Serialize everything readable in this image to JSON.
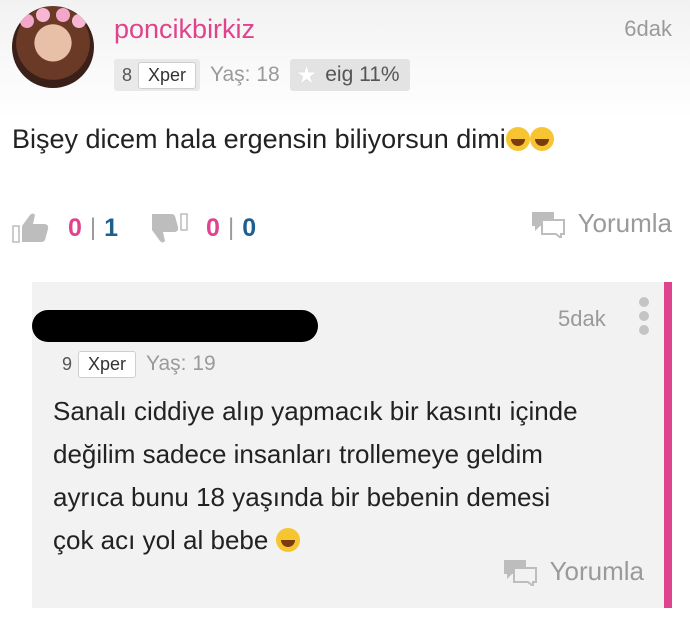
{
  "post": {
    "username": "poncikbirkiz",
    "time": "6dak",
    "level": "8",
    "level_tag": "Xper",
    "age": "Yaş: 18",
    "eig": "eig 11%",
    "text": "Bişey dicem hala ergensin biliyorsun dimi",
    "likes": {
      "pink": "0",
      "blue": "1"
    },
    "dislikes": {
      "pink": "0",
      "blue": "0"
    },
    "separator": "|",
    "reply_label": "Yorumla"
  },
  "reply": {
    "time": "5dak",
    "level": "9",
    "level_tag": "Xper",
    "age": "Yaş: 19",
    "lines": [
      "Sanalı ciddiye alıp yapmacık bir kasıntı içinde",
      "değilim sadece insanları trollemeye geldim",
      "ayrıca bunu 18 yaşında bir bebenin demesi",
      "çok acı yol al bebe"
    ],
    "reply_label": "Yorumla"
  },
  "colors": {
    "accent_pink": "#e0438d",
    "count_blue": "#1f5f8f",
    "muted_gray": "#9a9a9a"
  },
  "icons": [
    "avatar",
    "star-icon",
    "thumbs-up-icon",
    "thumbs-down-icon",
    "chat-bubble-icon",
    "laughing-emoji-icon",
    "grinning-emoji-icon",
    "more-vertical-icon"
  ]
}
